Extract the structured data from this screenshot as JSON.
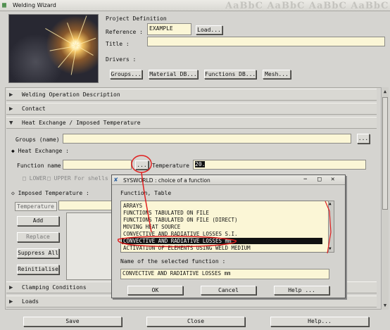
{
  "window": {
    "title": "Welding Wizard",
    "ghost_text": "AaBbC AaBbC AaBbC AaBbC",
    "buttons": {
      "minimize": "−",
      "maximize": "□",
      "close": "✕"
    }
  },
  "project": {
    "heading": "Project Definition",
    "reference_label": "Reference :",
    "reference_value": "EXAMPLE",
    "load_label": "Load...",
    "title_label": "Title :",
    "title_value": "",
    "drivers_label": "Drivers :",
    "driver_buttons": [
      "Groups...",
      "Material DB...",
      "Functions DB...",
      "Mesh..."
    ]
  },
  "sections": {
    "welding_operation": "Welding Operation Description",
    "contact": "Contact",
    "heat_exchange": "Heat Exchange / Imposed Temperature",
    "clamping": "Clamping Conditions",
    "loads": "Loads"
  },
  "heat": {
    "groups_label": "Groups (name)",
    "groups_value": "",
    "groups_btn": "...",
    "heat_exchange_radio": "Heat Exchange :",
    "function_name_label": "Function name",
    "function_name_value": "",
    "function_btn": "...",
    "temperature_label": "Temperature",
    "temperature_value": "20.",
    "lower_label": "LOWER",
    "upper_label": "UPPER For shells",
    "imposed_radio": "Imposed Temperature :",
    "temp_tab": "Temperature",
    "temp_tab_value": "",
    "side_buttons": [
      "Add",
      "Replace",
      "Suppress All",
      "Reinitialise"
    ]
  },
  "bottom_buttons": {
    "save": "Save",
    "close": "Close",
    "help": "Help..."
  },
  "dialog": {
    "title": "SYSWORLD : choice of a function",
    "list_header": "Function, Table",
    "items": [
      "ARRAYS",
      "FUNCTIONS TABULATED ON FILE",
      "FUNCTIONS TABULATED ON FILE (DIRECT)",
      "MOVING HEAT SOURCE",
      "CONVECTIVE AND RADIATIVE LOSSES S.I.",
      "CONVECTIVE AND RADIATIVE LOSSES mm",
      "ACTIVATION OF ELEMENTS USING WELD MEDIUM"
    ],
    "selected_index": 5,
    "selected_label": "Name of the selected function :",
    "selected_value": "CONVECTIVE AND RADIATIVE LOSSES mm",
    "ok": "OK",
    "cancel": "Cancel",
    "help": "Help ..."
  },
  "colors": {
    "field_bg": "#fbf6d6",
    "annotation": "#e02020",
    "selection_bg": "#111111"
  }
}
